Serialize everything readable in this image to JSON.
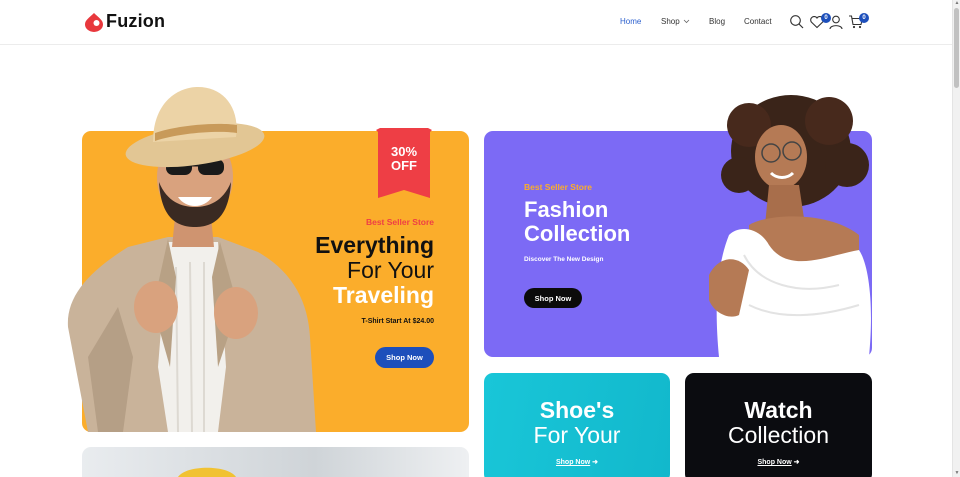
{
  "brand": {
    "name": "Fuzion",
    "accent": "#e8383d"
  },
  "nav": {
    "items": [
      {
        "label": "Home",
        "active": true
      },
      {
        "label": "Shop",
        "has_dropdown": true
      },
      {
        "label": "Blog"
      },
      {
        "label": "Contact"
      }
    ],
    "icons": [
      "search-icon",
      "heart-icon",
      "user-icon",
      "cart-icon"
    ],
    "wishlist_count": "0",
    "cart_count": "0"
  },
  "hero_left": {
    "background": "#fbad2b",
    "discount": {
      "percent": "30%",
      "label": "OFF"
    },
    "eyebrow": "Best Seller Store",
    "title_line1": "Everything",
    "title_line2": "For Your",
    "title_line3": "Traveling",
    "subtitle": "T-Shirt Start At $24.00",
    "button": "Shop Now"
  },
  "hero_right": {
    "background": "#7c6af5",
    "eyebrow": "Best Seller Store",
    "title_line1": "Fashion",
    "title_line2": "Collection",
    "subtitle": "Discover The New Design",
    "button": "Shop Now"
  },
  "promo_shoes": {
    "background": "#15bfd2",
    "title_line1": "Shoe's",
    "title_line2": "For Your",
    "link": "Shop Now"
  },
  "promo_watch": {
    "background": "#0b0c10",
    "title_line1": "Watch",
    "title_line2": "Collection",
    "link": "Shop Now"
  }
}
